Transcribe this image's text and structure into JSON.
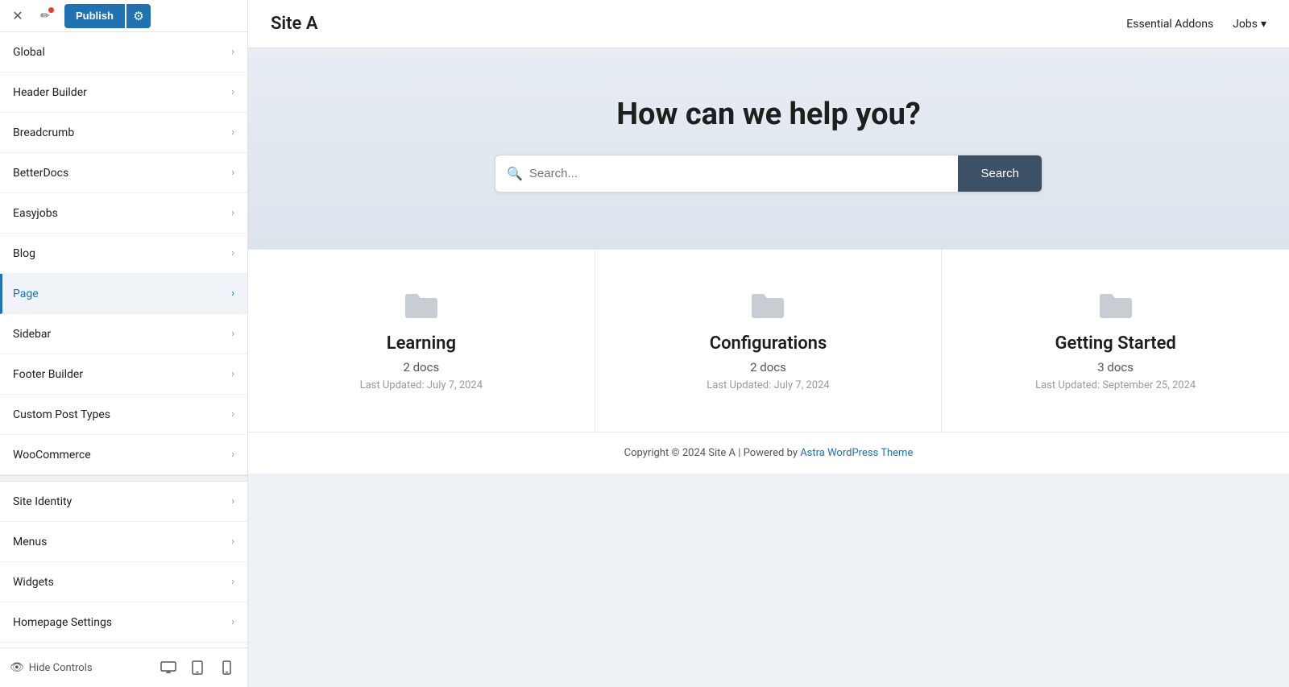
{
  "topbar": {
    "close_icon": "✕",
    "pen_icon": "✏",
    "publish_label": "Publish",
    "settings_icon": "⚙"
  },
  "sidebar": {
    "items": [
      {
        "id": "global",
        "label": "Global",
        "active": false
      },
      {
        "id": "header-builder",
        "label": "Header Builder",
        "active": false
      },
      {
        "id": "breadcrumb",
        "label": "Breadcrumb",
        "active": false
      },
      {
        "id": "betterdocs",
        "label": "BetterDocs",
        "active": false
      },
      {
        "id": "easyjobs",
        "label": "Easyjobs",
        "active": false
      },
      {
        "id": "blog",
        "label": "Blog",
        "active": false
      },
      {
        "id": "page",
        "label": "Page",
        "active": true
      },
      {
        "id": "sidebar",
        "label": "Sidebar",
        "active": false
      },
      {
        "id": "footer-builder",
        "label": "Footer Builder",
        "active": false
      },
      {
        "id": "custom-post-types",
        "label": "Custom Post Types",
        "active": false
      },
      {
        "id": "woocommerce",
        "label": "WooCommerce",
        "active": false
      }
    ],
    "items2": [
      {
        "id": "site-identity",
        "label": "Site Identity",
        "active": false
      },
      {
        "id": "menus",
        "label": "Menus",
        "active": false
      },
      {
        "id": "widgets",
        "label": "Widgets",
        "active": false
      },
      {
        "id": "homepage-settings",
        "label": "Homepage Settings",
        "active": false
      }
    ],
    "hide_controls": "Hide Controls",
    "view_desktop_icon": "🖥",
    "view_tablet_icon": "📄",
    "view_mobile_icon": "📱"
  },
  "nav": {
    "site_title": "Site A",
    "essential_addons": "Essential Addons",
    "jobs_label": "Jobs",
    "jobs_arrow": "▾"
  },
  "hero": {
    "title": "How can we help you?",
    "search_placeholder": "Search...",
    "search_button": "Search"
  },
  "cards": [
    {
      "title": "Learning",
      "docs": "2 docs",
      "updated": "Last Updated: July 7, 2024"
    },
    {
      "title": "Configurations",
      "docs": "2 docs",
      "updated": "Last Updated: July 7, 2024"
    },
    {
      "title": "Getting Started",
      "docs": "3 docs",
      "updated": "Last Updated: September 25, 2024"
    }
  ],
  "footer": {
    "text": "Copyright © 2024 Site A | Powered by ",
    "link_text": "Astra WordPress Theme"
  }
}
